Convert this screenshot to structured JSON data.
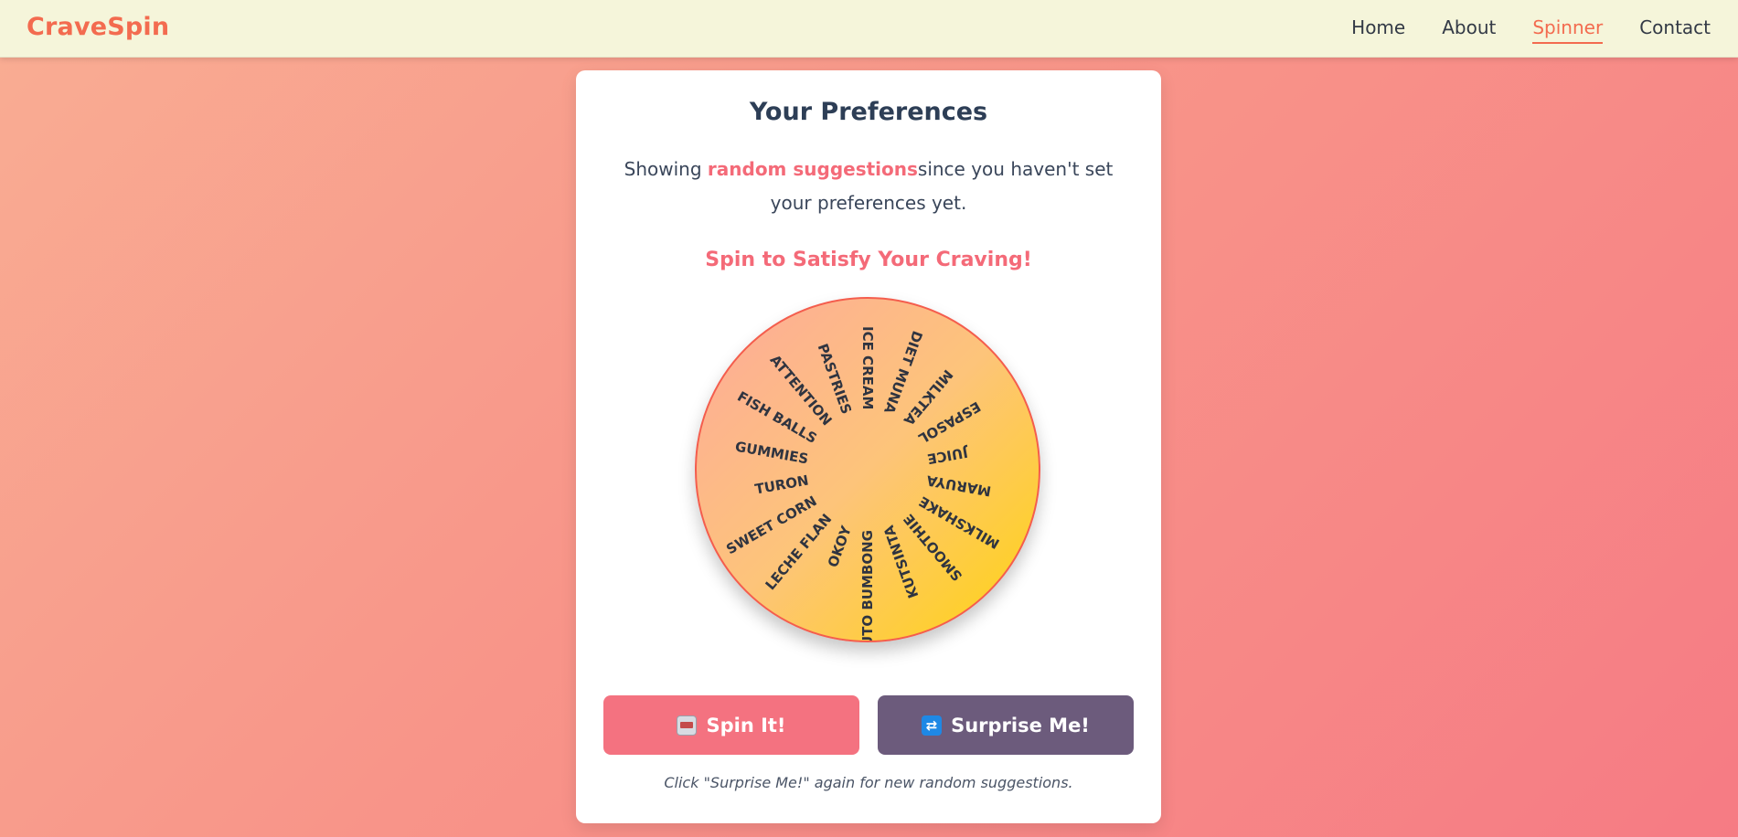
{
  "brand": "CraveSpin",
  "nav": {
    "links": [
      "Home",
      "About",
      "Spinner",
      "Contact"
    ],
    "active": "Spinner"
  },
  "card": {
    "title": "Your Preferences",
    "pref_prefix": "Showing ",
    "pref_highlight": "random suggestions",
    "pref_suffix": "since you haven't set your preferences yet.",
    "spin_heading": "Spin to Satisfy Your Craving!"
  },
  "wheel": {
    "items": [
      "ICE CREAM",
      "DIET MUNA",
      "MILKTEA",
      "ESPASOL",
      "JUICE",
      "MARUYA",
      "MILKSHAKE",
      "SMOOTHIE",
      "KUTSINTA",
      "PUTO BUMBONG",
      "OKOY",
      "LECHE FLAN",
      "SWEET CORN",
      "TURON",
      "GUMMIES",
      "FISH BALLS",
      "ATTENTION",
      "PASTRIES"
    ]
  },
  "buttons": {
    "spin_label": "Spin It!",
    "spin_icon": "slot-machine-icon",
    "surprise_label": "Surprise Me!",
    "surprise_icon": "shuffle-icon"
  },
  "hint": "Click \"Surprise Me!\" again for new random suggestions.",
  "colors": {
    "accent": "#f36b4f",
    "highlight": "#f46a78",
    "spin_button": "#f47280",
    "surprise_button": "#6c5b7c",
    "navbar": "#f5f5da"
  }
}
